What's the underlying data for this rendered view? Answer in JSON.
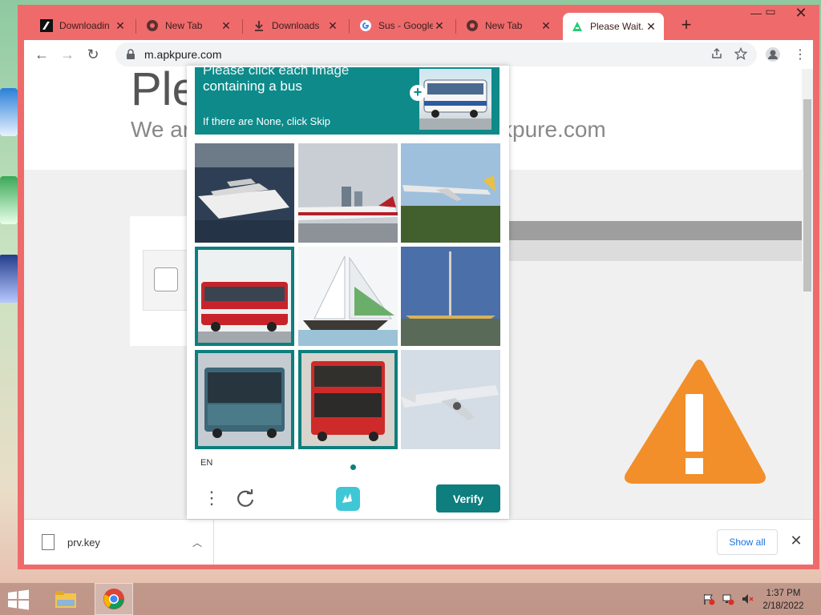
{
  "tabs": [
    {
      "label": "Downloadin",
      "icon": "apkpure-icon"
    },
    {
      "label": "New Tab",
      "icon": "chrome-icon"
    },
    {
      "label": "Downloads",
      "icon": "download-icon"
    },
    {
      "label": "Sus - Google",
      "icon": "google-icon"
    },
    {
      "label": "New Tab",
      "icon": "chrome-icon"
    },
    {
      "label": "Please Wait...",
      "icon": "apkpure-icon",
      "active": true
    }
  ],
  "address": {
    "url": "m.apkpure.com"
  },
  "page": {
    "title": "Ple",
    "subtitle_left": "We ar",
    "subtitle_right": "kpure.com"
  },
  "captcha": {
    "prompt_line1": "Please click each image",
    "prompt_line2": "containing a bus",
    "skip_hint": "If there are None, click Skip",
    "language": "EN",
    "verify_label": "Verify",
    "tiles": [
      {
        "subject": "yacht",
        "selected": false
      },
      {
        "subject": "airplane",
        "selected": false
      },
      {
        "subject": "airplane",
        "selected": false
      },
      {
        "subject": "bus",
        "selected": true
      },
      {
        "subject": "sailboat",
        "selected": false
      },
      {
        "subject": "sailboat",
        "selected": false
      },
      {
        "subject": "bus",
        "selected": true
      },
      {
        "subject": "bus",
        "selected": true
      },
      {
        "subject": "airplane",
        "selected": false
      }
    ]
  },
  "downloads": {
    "file_name": "prv.key",
    "show_all_label": "Show all"
  },
  "taskbar": {
    "time": "1:37 PM",
    "date": "2/18/2022"
  },
  "colors": {
    "chrome_frame": "#ef6b6b",
    "captcha_accent": "#0e7e7e",
    "warning": "#f28f2a"
  }
}
